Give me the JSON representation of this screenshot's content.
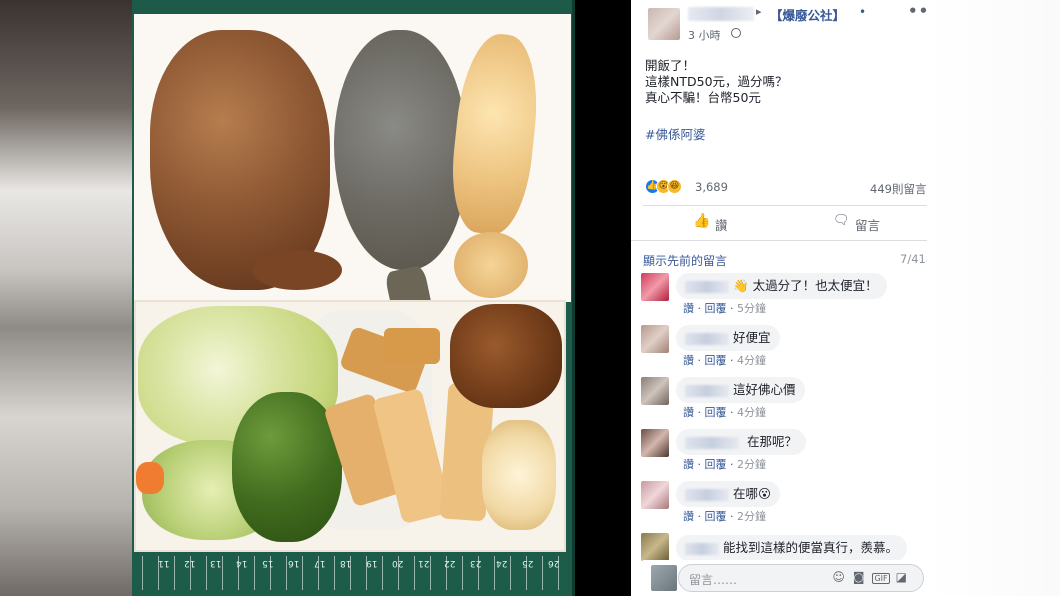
{
  "post": {
    "group_name": "【爆廢公社】",
    "time": "3 小時",
    "lines": [
      "開飯了！",
      "這樣NTD50元，過分嗎？",
      "真心不騙！台幣50元"
    ],
    "hashtag": "#佛係阿婆",
    "reaction_count": "3,689",
    "comment_count": "449則留言",
    "like_label": "讚",
    "comment_label": "留言",
    "more_icon": "•••"
  },
  "comments_header": {
    "show_previous": "顯示先前的留言",
    "count": "7/418"
  },
  "comments": [
    {
      "text": "太過分了！也太便宜！",
      "emoji": "👋",
      "like": "讚",
      "reply": "回覆",
      "time": "5分鐘"
    },
    {
      "text": "好便宜",
      "like": "讚",
      "reply": "回覆",
      "time": "4分鐘"
    },
    {
      "text": "這好佛心價",
      "like": "讚",
      "reply": "回覆",
      "time": "4分鐘"
    },
    {
      "text": "在那呢？",
      "like": "讚",
      "reply": "回覆",
      "time": "2分鐘"
    },
    {
      "text": "在哪",
      "emoji": "😮",
      "like": "讚",
      "reply": "回覆",
      "time": "2分鐘"
    },
    {
      "text": "能找到這樣的便當真行，羨慕。"
    }
  ],
  "input": {
    "placeholder": "留言……"
  },
  "ruler": {
    "numbers": [
      "26",
      "25",
      "24",
      "23",
      "22",
      "21",
      "20",
      "19",
      "18",
      "17",
      "16",
      "15",
      "14",
      "13",
      "12",
      "11"
    ]
  }
}
